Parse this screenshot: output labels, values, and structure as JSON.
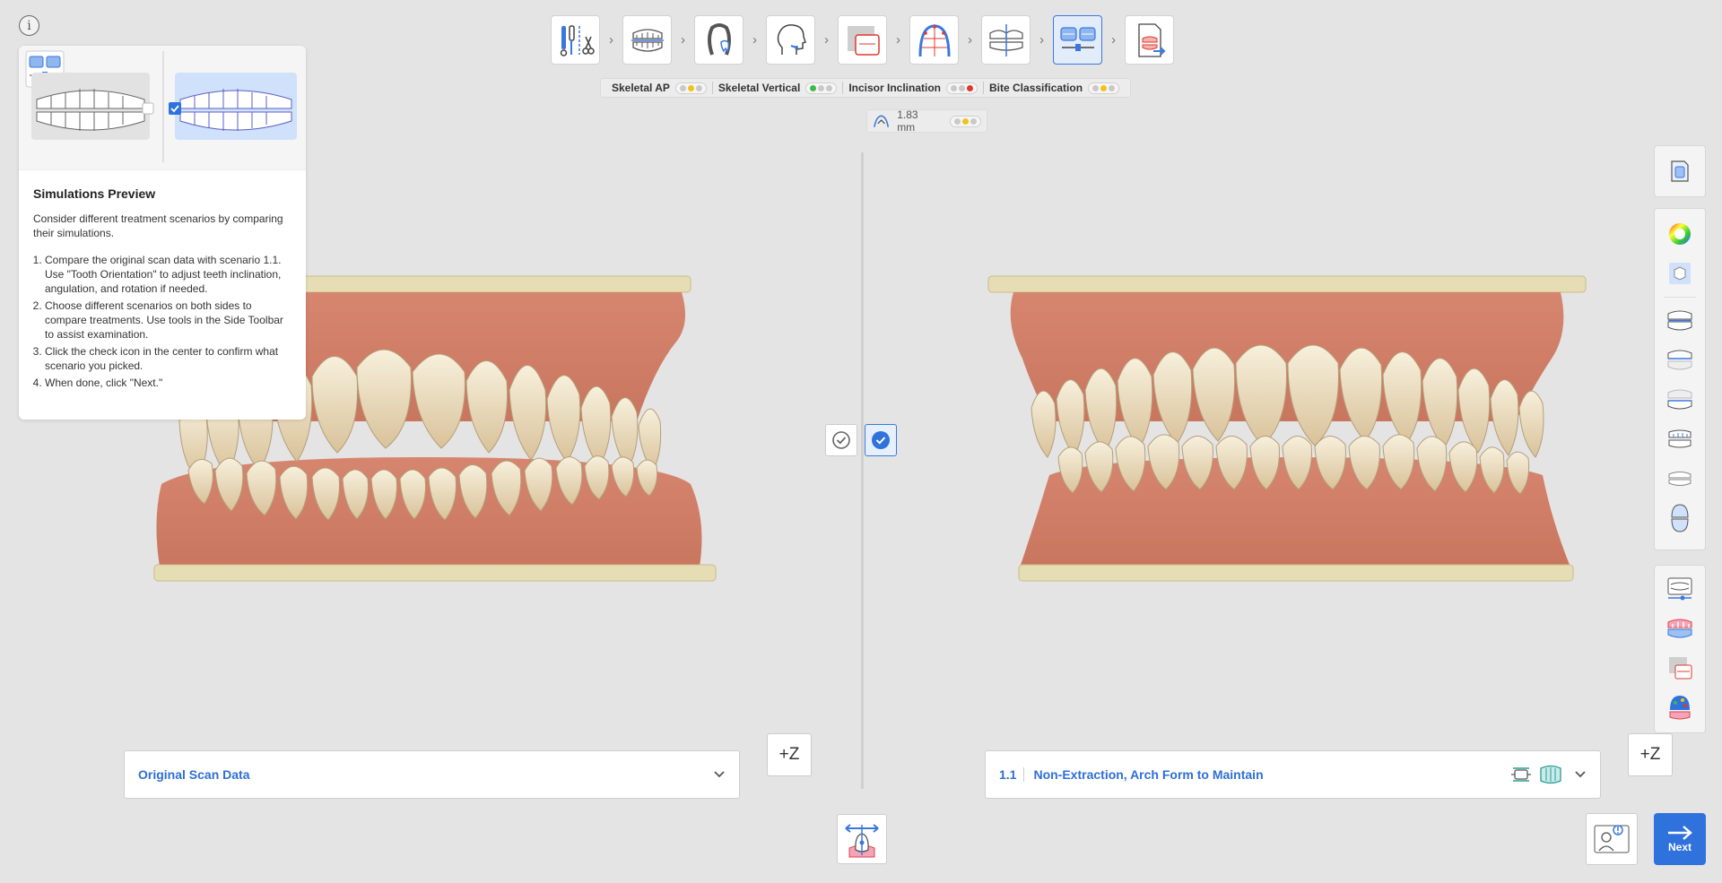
{
  "info_label": "i",
  "classification": [
    {
      "label": "Skeletal AP",
      "lights": [
        "#c9c9c9",
        "#f2c21b",
        "#c9c9c9"
      ]
    },
    {
      "label": "Skeletal Vertical",
      "lights": [
        "#3cba4c",
        "#c9c9c9",
        "#c9c9c9"
      ]
    },
    {
      "label": "Incisor Inclination",
      "lights": [
        "#c9c9c9",
        "#c9c9c9",
        "#e2372b"
      ]
    },
    {
      "label": "Bite Classification",
      "lights": [
        "#c9c9c9",
        "#f2c21b",
        "#c9c9c9"
      ]
    }
  ],
  "measurement": {
    "value": "1.83 mm",
    "lights": [
      "#c9c9c9",
      "#f2c21b",
      "#c9c9c9"
    ]
  },
  "help": {
    "title": "Simulations Preview",
    "description": "Consider different treatment scenarios by comparing their simulations.",
    "steps": [
      "Compare the original scan data with scenario 1.1. Use \"Tooth Orientation\" to adjust teeth inclination, angulation, and rotation if needed.",
      "Choose different scenarios on both sides to compare treatments. Use tools in the Side Toolbar to assist examination.",
      "Click the check icon in the center to confirm what scenario you picked.",
      "When done, click \"Next.\""
    ]
  },
  "left_scenario": {
    "label": "Original Scan Data"
  },
  "right_scenario": {
    "number": "1.1",
    "label": "Non-Extraction, Arch Form to Maintain"
  },
  "zoom_label": "+Z",
  "next_label": "Next",
  "colors": {
    "accent": "#2f72de",
    "gum": "#d98a74",
    "tooth": "#efe6cf",
    "base": "#e8dfb8"
  }
}
